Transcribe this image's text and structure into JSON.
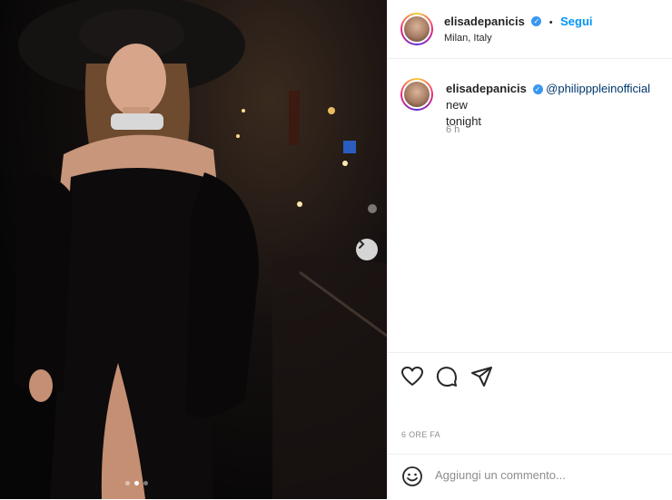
{
  "post": {
    "username": "elisadepanicis",
    "separator": "•",
    "follow_label": "Segui",
    "location": "Milan, Italy",
    "caption_mention": "@philipppleinofficial",
    "caption_text_after": " new",
    "caption_line2": "tonight",
    "comment_time": "6 h",
    "date_label": "6 ORE FA",
    "comment_placeholder": "Aggiungi un commento..."
  },
  "carousel": {
    "dots": 3,
    "active_index": 1
  },
  "colors": {
    "accent": "#0095f6",
    "verified": "#3897f0",
    "text": "#262626",
    "muted": "#8e8e8e"
  },
  "icons": {
    "like": "heart-icon",
    "comment": "comment-icon",
    "share": "paper-plane-icon",
    "emoji": "smiley-icon",
    "next": "chevron-right-icon",
    "verified": "verified-badge-icon"
  }
}
